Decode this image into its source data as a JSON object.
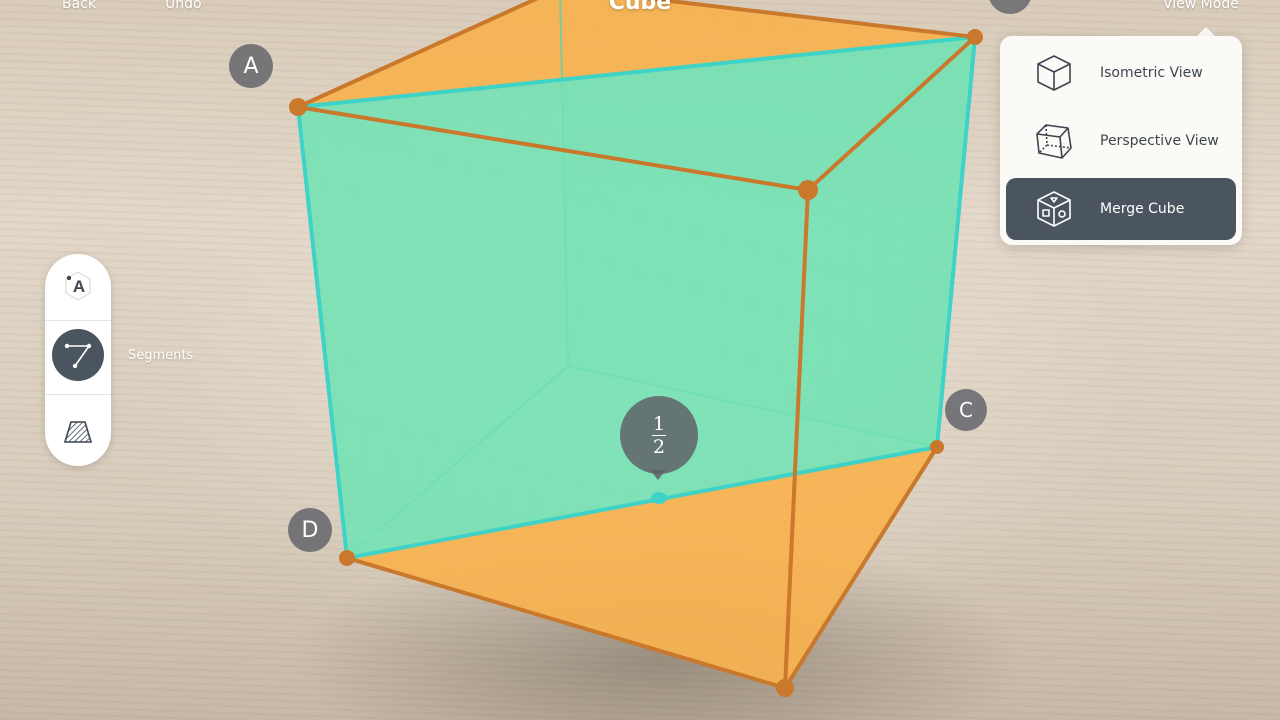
{
  "header": {
    "back_label": "Back",
    "undo_label": "Undo",
    "title": "Cube",
    "view_mode_label": "View Mode"
  },
  "vertex_labels": {
    "a": "A",
    "c": "C",
    "d": "D"
  },
  "midpoint_label": {
    "numerator": "1",
    "denominator": "2"
  },
  "tools": {
    "point_icon_letter": "A",
    "active_caption": "Segments"
  },
  "view_menu": {
    "items": [
      {
        "label": "Isometric View",
        "icon": "isometric-cube-icon"
      },
      {
        "label": "Perspective View",
        "icon": "perspective-cube-icon"
      },
      {
        "label": "Merge Cube",
        "icon": "merge-cube-icon",
        "selected": true
      }
    ]
  },
  "colors": {
    "plane_fill": "#6fe3b4",
    "plane_edge": "#3fd3c7",
    "face_fill": "#f7b24e",
    "edge": "#c9782c",
    "panel_dark": "#4b5560"
  }
}
